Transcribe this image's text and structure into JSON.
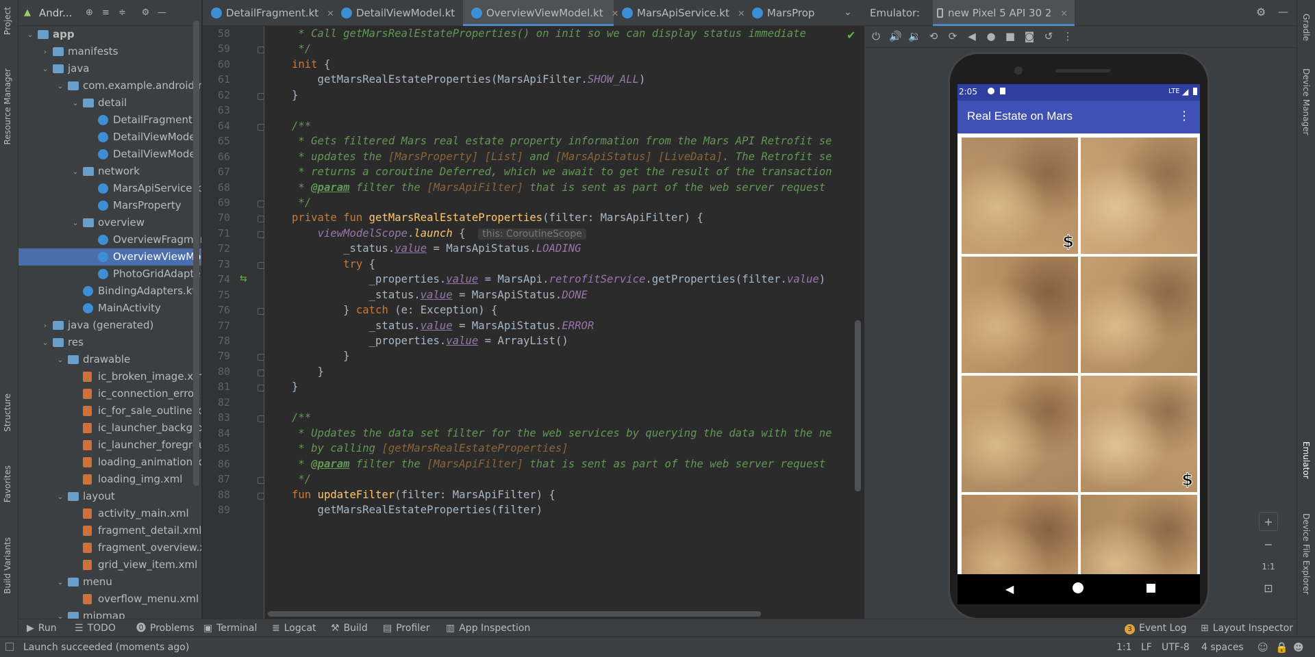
{
  "left_strip": {
    "tabs": [
      "Project",
      "Resource Manager",
      "Structure",
      "Favorites",
      "Build Variants"
    ]
  },
  "right_strip": {
    "tabs": [
      "Gradle",
      "Device Manager",
      "Emulator",
      "Device File Explorer"
    ]
  },
  "project_panel": {
    "title": "Andr...",
    "tree": [
      {
        "label": "app",
        "depth": 0,
        "icon": "folder",
        "open": true,
        "bold": true
      },
      {
        "label": "manifests",
        "depth": 1,
        "icon": "folder",
        "open": false
      },
      {
        "label": "java",
        "depth": 1,
        "icon": "folder",
        "open": true
      },
      {
        "label": "com.example.android.m",
        "depth": 2,
        "icon": "folder",
        "open": true
      },
      {
        "label": "detail",
        "depth": 3,
        "icon": "folder",
        "open": true
      },
      {
        "label": "DetailFragment",
        "depth": 4,
        "icon": "kt"
      },
      {
        "label": "DetailViewModel",
        "depth": 4,
        "icon": "kt"
      },
      {
        "label": "DetailViewModel",
        "depth": 4,
        "icon": "kt"
      },
      {
        "label": "network",
        "depth": 3,
        "icon": "folder",
        "open": true
      },
      {
        "label": "MarsApiService.k",
        "depth": 4,
        "icon": "kt"
      },
      {
        "label": "MarsProperty",
        "depth": 4,
        "icon": "kt"
      },
      {
        "label": "overview",
        "depth": 3,
        "icon": "folder",
        "open": true
      },
      {
        "label": "OverviewFragmen",
        "depth": 4,
        "icon": "kt"
      },
      {
        "label": "OverviewViewMo",
        "depth": 4,
        "icon": "kt",
        "selected": true
      },
      {
        "label": "PhotoGridAdapte",
        "depth": 4,
        "icon": "kt"
      },
      {
        "label": "BindingAdapters.kt",
        "depth": 3,
        "icon": "kt"
      },
      {
        "label": "MainActivity",
        "depth": 3,
        "icon": "kt"
      },
      {
        "label": "java (generated)",
        "depth": 1,
        "icon": "folder",
        "open": false
      },
      {
        "label": "res",
        "depth": 1,
        "icon": "folder",
        "open": true
      },
      {
        "label": "drawable",
        "depth": 2,
        "icon": "folder",
        "open": true
      },
      {
        "label": "ic_broken_image.xm",
        "depth": 3,
        "icon": "xml"
      },
      {
        "label": "ic_connection_error.",
        "depth": 3,
        "icon": "xml"
      },
      {
        "label": "ic_for_sale_outline.x",
        "depth": 3,
        "icon": "xml"
      },
      {
        "label": "ic_launcher_backgro",
        "depth": 3,
        "icon": "xml"
      },
      {
        "label": "ic_launcher_foregrou",
        "depth": 3,
        "icon": "xml"
      },
      {
        "label": "loading_animation.x",
        "depth": 3,
        "icon": "xml"
      },
      {
        "label": "loading_img.xml",
        "depth": 3,
        "icon": "xml"
      },
      {
        "label": "layout",
        "depth": 2,
        "icon": "folder",
        "open": true
      },
      {
        "label": "activity_main.xml",
        "depth": 3,
        "icon": "xml"
      },
      {
        "label": "fragment_detail.xml",
        "depth": 3,
        "icon": "xml"
      },
      {
        "label": "fragment_overview.x",
        "depth": 3,
        "icon": "xml"
      },
      {
        "label": "grid_view_item.xml",
        "depth": 3,
        "icon": "xml"
      },
      {
        "label": "menu",
        "depth": 2,
        "icon": "folder",
        "open": true
      },
      {
        "label": "overflow_menu.xml",
        "depth": 3,
        "icon": "xml"
      },
      {
        "label": "mipmap",
        "depth": 2,
        "icon": "folder",
        "open": true
      }
    ]
  },
  "editor_tabs": [
    {
      "label": "DetailFragment.kt",
      "active": false
    },
    {
      "label": "DetailViewModel.kt",
      "active": false
    },
    {
      "label": "OverviewViewModel.kt",
      "active": true
    },
    {
      "label": "MarsApiService.kt",
      "active": false
    },
    {
      "label": "MarsProp",
      "active": false
    }
  ],
  "code_lines": [
    {
      "n": "58",
      "html": "<span class='cm'> * Call getMarsRealEstateProperties() on init so we can display status immediate</span>"
    },
    {
      "n": "59",
      "html": "<span class='cm'> */</span>"
    },
    {
      "n": "60",
      "html": "<span class='kw'>init</span> {"
    },
    {
      "n": "61",
      "html": "    getMarsRealEstateProperties(MarsApiFilter.<span class='prop'>SHOW_ALL</span>)"
    },
    {
      "n": "62",
      "html": "}"
    },
    {
      "n": "63",
      "html": ""
    },
    {
      "n": "64",
      "html": "<span class='cm'>/**</span>"
    },
    {
      "n": "65",
      "html": "<span class='cm'> * Gets filtered Mars real estate property information from the Mars API Retrofit se</span>"
    },
    {
      "n": "66",
      "html": "<span class='cm'> * updates the </span><span class='cmref'>[MarsProperty] [List]</span><span class='cm'> and </span><span class='cmref'>[MarsApiStatus] [LiveData]</span><span class='cm'>. The Retrofit se</span>"
    },
    {
      "n": "67",
      "html": "<span class='cm'> * returns a coroutine Deferred, which we await to get the result of the transaction</span>"
    },
    {
      "n": "68",
      "html": "<span class='cm'> * </span><span class='cmtag'>@param</span><span class='cm'> filter the </span><span class='cmref'>[MarsApiFilter]</span><span class='cm'> that is sent as part of the web server request</span>"
    },
    {
      "n": "69",
      "html": "<span class='cm'> */</span>"
    },
    {
      "n": "70",
      "html": "<span class='kw'>private fun </span><span class='fn'>getMarsRealEstateProperties</span>(filter: MarsApiFilter) {"
    },
    {
      "n": "71",
      "html": "    <span class='prop'>viewModelScope</span>.<span class='ext'>launch</span> {  <span class='hint'>this: CoroutineScope</span>"
    },
    {
      "n": "72",
      "html": "        _status.<span class='propu'>value</span> = MarsApiStatus.<span class='prop'>LOADING</span>"
    },
    {
      "n": "73",
      "html": "        <span class='kw'>try</span> {"
    },
    {
      "n": "74",
      "html": "            _properties.<span class='propu'>value</span> = MarsApi.<span class='prop'>retrofitService</span>.getProperties(filter.<span class='prop'>value</span>)"
    },
    {
      "n": "75",
      "html": "            _status.<span class='propu'>value</span> = MarsApiStatus.<span class='prop'>DONE</span>"
    },
    {
      "n": "76",
      "html": "        } <span class='kw'>catch</span> (e: Exception) {"
    },
    {
      "n": "77",
      "html": "            _status.<span class='propu'>value</span> = MarsApiStatus.<span class='prop'>ERROR</span>"
    },
    {
      "n": "78",
      "html": "            _properties.<span class='propu'>value</span> = ArrayList()"
    },
    {
      "n": "79",
      "html": "        }"
    },
    {
      "n": "80",
      "html": "    }"
    },
    {
      "n": "81",
      "html": "}"
    },
    {
      "n": "82",
      "html": ""
    },
    {
      "n": "83",
      "html": "<span class='cm'>/**</span>"
    },
    {
      "n": "84",
      "html": "<span class='cm'> * Updates the data set filter for the web services by querying the data with the ne</span>"
    },
    {
      "n": "85",
      "html": "<span class='cm'> * by calling </span><span class='cmref'>[getMarsRealEstateProperties]</span>"
    },
    {
      "n": "86",
      "html": "<span class='cm'> * </span><span class='cmtag'>@param</span><span class='cm'> filter the </span><span class='cmref'>[MarsApiFilter]</span><span class='cm'> that is sent as part of the web server request</span>"
    },
    {
      "n": "87",
      "html": "<span class='cm'> */</span>"
    },
    {
      "n": "88",
      "html": "<span class='kw'>fun </span><span class='fn'>updateFilter</span>(filter: MarsApiFilter) {"
    },
    {
      "n": "89",
      "html": "    getMarsRealEstateProperties(filter)"
    }
  ],
  "emulator": {
    "label": "Emulator:",
    "device_tab": "new Pixel 5 API 30 2",
    "status_time": "2:05",
    "status_right": "LTE",
    "app_title": "Real Estate on Mars",
    "tiles": [
      {
        "dollar": true
      },
      {
        "dollar": false
      },
      {
        "dollar": false
      },
      {
        "dollar": false
      },
      {
        "dollar": false
      },
      {
        "dollar": true
      },
      {
        "dollar": false
      },
      {
        "dollar": false
      }
    ],
    "zoom_label": "1:1"
  },
  "bottom_tabs": {
    "run": "Run",
    "todo": "TODO",
    "problems": "Problems",
    "terminal": "Terminal",
    "logcat": "Logcat",
    "build": "Build",
    "profiler": "Profiler",
    "app_inspection": "App Inspection",
    "event_log": "Event Log",
    "event_log_count": "3",
    "layout_inspector": "Layout Inspector"
  },
  "status_bar": {
    "message": "Launch succeeded (moments ago)",
    "position": "1:1",
    "line_sep": "LF",
    "encoding": "UTF-8",
    "indent": "4 spaces"
  }
}
